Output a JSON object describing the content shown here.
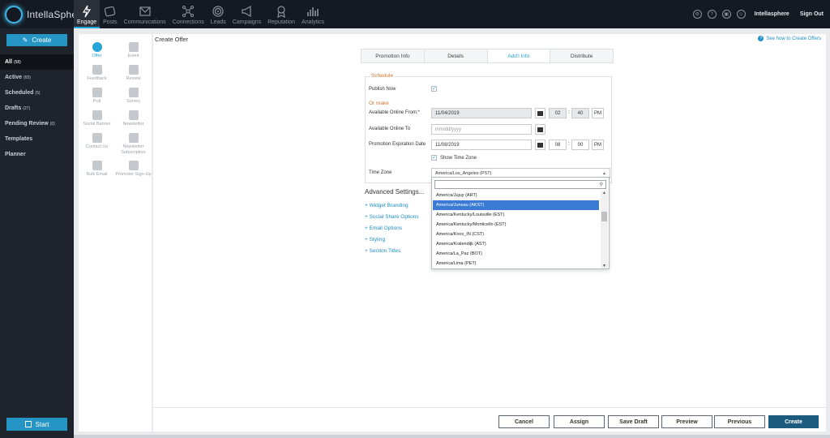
{
  "app": {
    "logo_text": "IntellaSphere"
  },
  "nav": [
    {
      "label": "Engage",
      "icon": "engage-icon",
      "active": true
    },
    {
      "label": "Posts",
      "icon": "posts-icon"
    },
    {
      "label": "Communications",
      "icon": "communications-icon"
    },
    {
      "label": "Connections",
      "icon": "connections-icon"
    },
    {
      "label": "Leads",
      "icon": "leads-icon"
    },
    {
      "label": "Campaigns",
      "icon": "campaigns-icon"
    },
    {
      "label": "Reputation",
      "icon": "reputation-icon"
    },
    {
      "label": "Analytics",
      "icon": "analytics-icon"
    }
  ],
  "topright": {
    "user": "Intellasphere",
    "signout": "Sign Out"
  },
  "sidebar": {
    "create_label": "Create",
    "items": [
      {
        "label": "All",
        "count": "(58)",
        "active": true
      },
      {
        "label": "Active",
        "count": "(65)"
      },
      {
        "label": "Scheduled",
        "count": "(5)"
      },
      {
        "label": "Drafts",
        "count": "(27)"
      },
      {
        "label": "Pending Review",
        "count": "(0)"
      },
      {
        "label": "Templates",
        "count": ""
      },
      {
        "label": "Planner",
        "count": ""
      }
    ],
    "start_label": "Start"
  },
  "widgets": [
    {
      "label": "Offer",
      "icon": "offer-icon",
      "active": true
    },
    {
      "label": "Event",
      "icon": "event-icon"
    },
    {
      "label": "Feedback",
      "icon": "feedback-icon"
    },
    {
      "label": "Review",
      "icon": "review-icon"
    },
    {
      "label": "Poll",
      "icon": "poll-icon"
    },
    {
      "label": "Survey",
      "icon": "survey-icon"
    },
    {
      "label": "Social Banner",
      "icon": "social-banner-icon"
    },
    {
      "label": "Newsletter",
      "icon": "newsletter-icon"
    },
    {
      "label": "Contact Us",
      "icon": "contact-us-icon"
    },
    {
      "label": "Newsletter Subscription",
      "icon": "newsletter-subscription-icon"
    },
    {
      "label": "Bulk Email",
      "icon": "bulk-email-icon"
    },
    {
      "label": "Promoter Sign-Up",
      "icon": "promoter-signup-icon"
    }
  ],
  "main": {
    "title": "Create Offer",
    "help_link": "See how to Create Offers",
    "steps": [
      {
        "label": "Promotion Info"
      },
      {
        "label": "Details"
      },
      {
        "label": "Add'l Info",
        "active": true
      },
      {
        "label": "Distribute"
      }
    ],
    "schedule": {
      "legend": "Schedule",
      "publish_now_label": "Publish Now",
      "or_make": "Or make",
      "online_from_label": "Available Online From:*",
      "online_from_value": "11/04/2019",
      "online_from_hour": "02",
      "online_from_min": "40",
      "online_from_ampm": "PM",
      "online_to_label": "Available Online To",
      "online_to_placeholder": "mm/dd/yyyy",
      "expiration_label": "Promotion Expiration Date",
      "expiration_value": "11/08/2019",
      "expiration_hour": "08",
      "expiration_min": "00",
      "expiration_ampm": "PM",
      "show_tz_label": "Show Time Zone",
      "tz_label": "Time Zone",
      "tz_value": "America/Los_Angeles (PST)"
    },
    "advanced": {
      "title": "Advanced Settings...",
      "items": [
        "+ Widget Branding",
        "+ Social Share Options",
        "+ Email Options",
        "+ Styling",
        "+ Section Titles"
      ]
    },
    "dropdown": {
      "options": [
        {
          "label": "America/Jujuy (ART)"
        },
        {
          "label": "America/Juneau (AKST)",
          "selected": true
        },
        {
          "label": "America/Kentucky/Louisville (EST)"
        },
        {
          "label": "America/Kentucky/Monticello (EST)"
        },
        {
          "label": "America/Knox_IN (CST)"
        },
        {
          "label": "America/Kralendijk (AST)"
        },
        {
          "label": "America/La_Paz (BOT)"
        },
        {
          "label": "America/Lima (PET)"
        }
      ]
    },
    "footer": {
      "cancel": "Cancel",
      "assign": "Assign",
      "save_draft": "Save Draft",
      "preview": "Preview",
      "previous": "Previous",
      "create": "Create"
    }
  }
}
